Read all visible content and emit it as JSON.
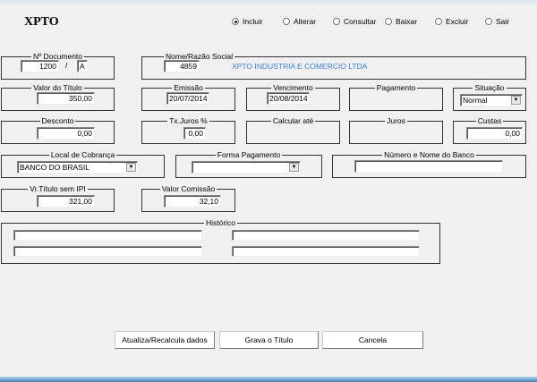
{
  "app": {
    "title": "XPTO"
  },
  "modes": [
    {
      "label": "Incluir",
      "selected": true
    },
    {
      "label": "Alterar",
      "selected": false
    },
    {
      "label": "Consultar",
      "selected": false
    },
    {
      "label": "Baixar",
      "selected": false
    },
    {
      "label": "Excluir",
      "selected": false
    },
    {
      "label": "Sair",
      "selected": false
    }
  ],
  "documento": {
    "label": "Nº Documento",
    "numero": "1200",
    "sep": "/",
    "serie": "A"
  },
  "cliente": {
    "label": "Nome/Razão Social",
    "codigo": "4859",
    "nome": "XPTO INDUSTRIA E COMERCIO LTDA",
    "name_color": "#3a7fd5"
  },
  "valor_titulo": {
    "label": "Valor do Título",
    "value": "350,00"
  },
  "emissao": {
    "label": "Emissão",
    "value": "20/07/2014"
  },
  "vencimento": {
    "label": "Vencimento",
    "value": "20/08/2014"
  },
  "pagamento": {
    "label": "Pagamento"
  },
  "situacao": {
    "label": "Situação",
    "value": "Normal"
  },
  "desconto": {
    "label": "Desconto",
    "value": "0,00"
  },
  "tx_juros": {
    "label": "Tx.Juros %",
    "value": "0,00"
  },
  "calcular_ate": {
    "label": "Calcular até"
  },
  "juros": {
    "label": "Juros"
  },
  "custas": {
    "label": "Custas",
    "value": "0,00"
  },
  "local_cobranca": {
    "label": "Local de Cobrança",
    "value": "BANCO DO BRASIL"
  },
  "forma_pagamento": {
    "label": "Forma Pagamento",
    "value": ""
  },
  "banco": {
    "label": "Número e Nome do Banco",
    "value": ""
  },
  "vr_sem_ipi": {
    "label": "Vr.Título sem IPI",
    "value": "321,00"
  },
  "comissao": {
    "label": "Valor Comissão",
    "value": "32,10"
  },
  "historico": {
    "label": "Histórico",
    "lines": [
      "",
      "",
      "",
      ""
    ]
  },
  "buttons": {
    "atualiza": "Atualiza/Recalcula dados",
    "grava": "Grava o Título",
    "cancela": "Cancela"
  }
}
